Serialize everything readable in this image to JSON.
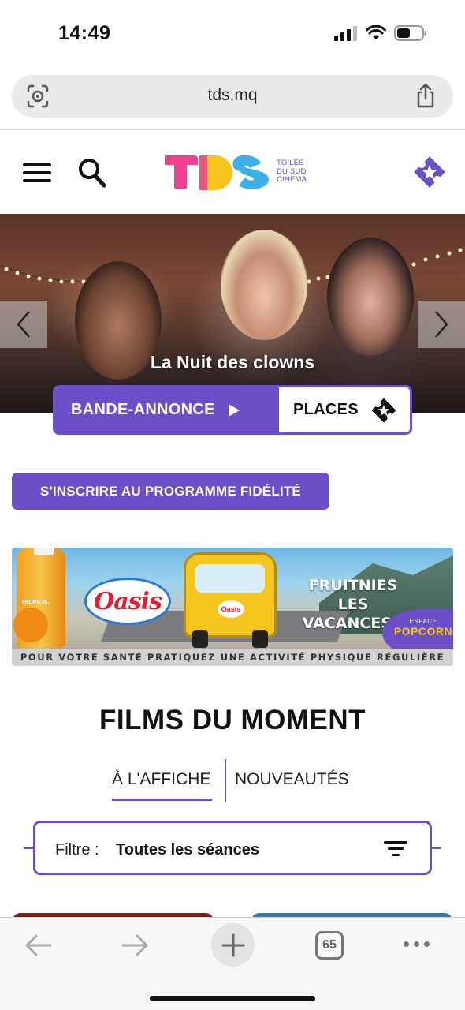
{
  "status_bar": {
    "time": "14:49"
  },
  "browser": {
    "url": "tds.mq",
    "open_tabs_count": "65"
  },
  "site": {
    "logo_letters": "TDS",
    "logo_subtitle_1": "TOILES",
    "logo_subtitle_2": "DU SUD",
    "logo_subtitle_3": "CINEMA"
  },
  "hero": {
    "title": "La Nuit des clowns",
    "trailer_label": "BANDE-ANNONCE",
    "tickets_label": "PLACES"
  },
  "fidelity_button": "S'INSCRIRE AU PROGRAMME FIDÉLITÉ",
  "ad": {
    "brand": "Oasis",
    "car_badge": "Oasis",
    "headline_1": "FRUITNIES",
    "headline_2": "LES VACANCES !",
    "popcorn_small": "ESPACE",
    "popcorn_big": "POPCORN",
    "bottle_label": "TROPICAL",
    "disclaimer": "POUR VOTRE SANTÉ PRATIQUEZ UNE ACTIVITÉ PHYSIQUE RÉGULIÈRE"
  },
  "section_title": "FILMS DU MOMENT",
  "tabs": [
    {
      "label": "À L'AFFICHE",
      "active": true
    },
    {
      "label": "NOUVEAUTÉS",
      "active": false
    }
  ],
  "filter": {
    "label": "Filtre :",
    "value": "Toutes les séances"
  },
  "colors": {
    "accent": "#6a4fc8",
    "logo_pink": "#ef3f8f",
    "logo_yellow": "#f6c51b",
    "logo_blue": "#3bb0e6"
  }
}
